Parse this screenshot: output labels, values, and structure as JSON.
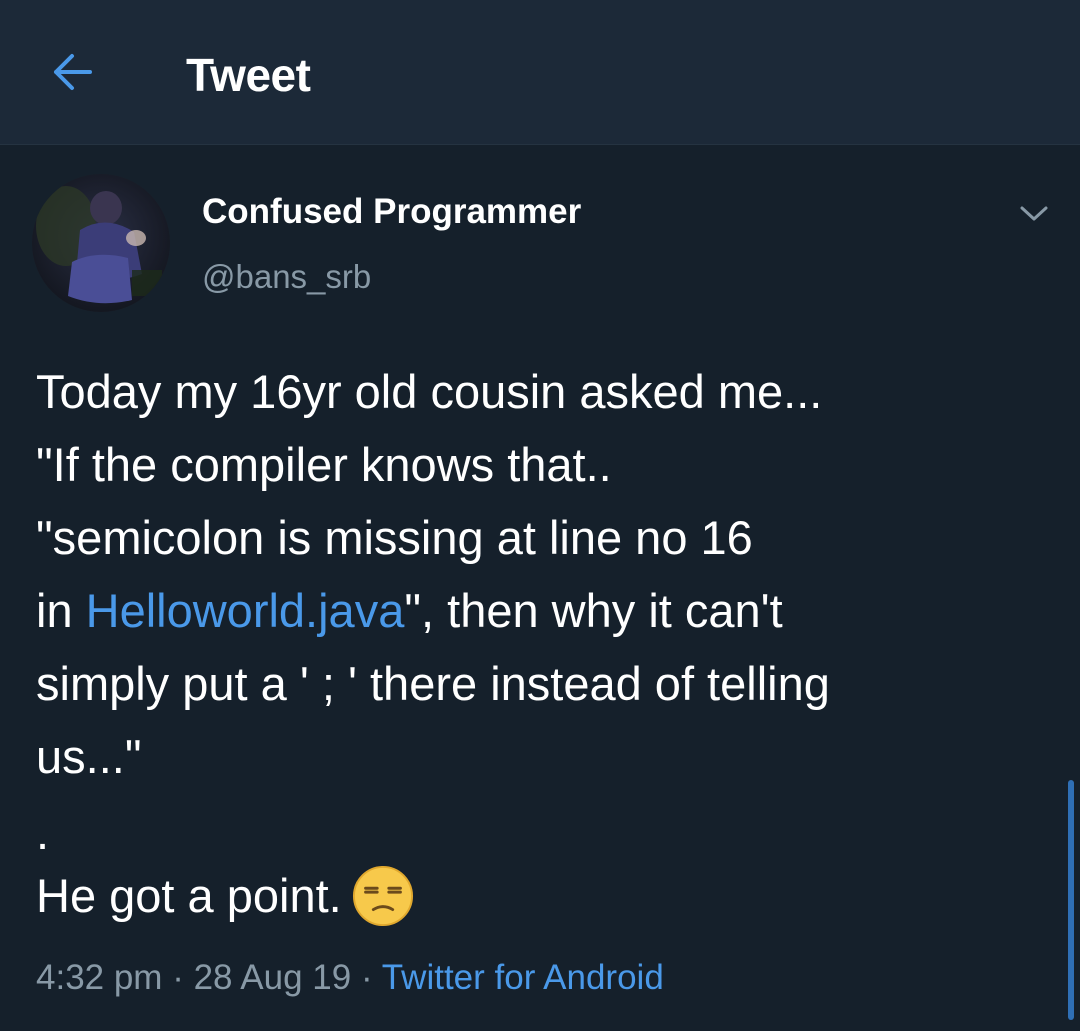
{
  "header": {
    "back_icon": "arrow-left-icon",
    "title": "Tweet"
  },
  "colors": {
    "background": "#15202b",
    "header_background": "#1c2938",
    "accent": "#4a99e9",
    "secondary_text": "#8899a6"
  },
  "tweet": {
    "author": {
      "display_name": "Confused Programmer",
      "handle": "@bans_srb",
      "avatar_icon": "profile-photo-avatar"
    },
    "menu_icon": "chevron-down-icon",
    "lines": [
      "Today my 16yr old cousin asked me...",
      "\"If the compiler knows that..",
      "\"semicolon is missing at line no 16"
    ],
    "line4_prefix": "in ",
    "line4_link": "Helloworld.java",
    "line4_suffix": "\", then why it can't",
    "lines_after": [
      "simply put a ' ; ' there instead of telling",
      "us...\"",
      "",
      "."
    ],
    "closing_text": "He got a point.",
    "closing_emoji": "unamused-face-emoji",
    "meta": {
      "time": "4:32 pm",
      "separator": " · ",
      "date": "28 Aug 19",
      "source": "Twitter for Android"
    }
  }
}
